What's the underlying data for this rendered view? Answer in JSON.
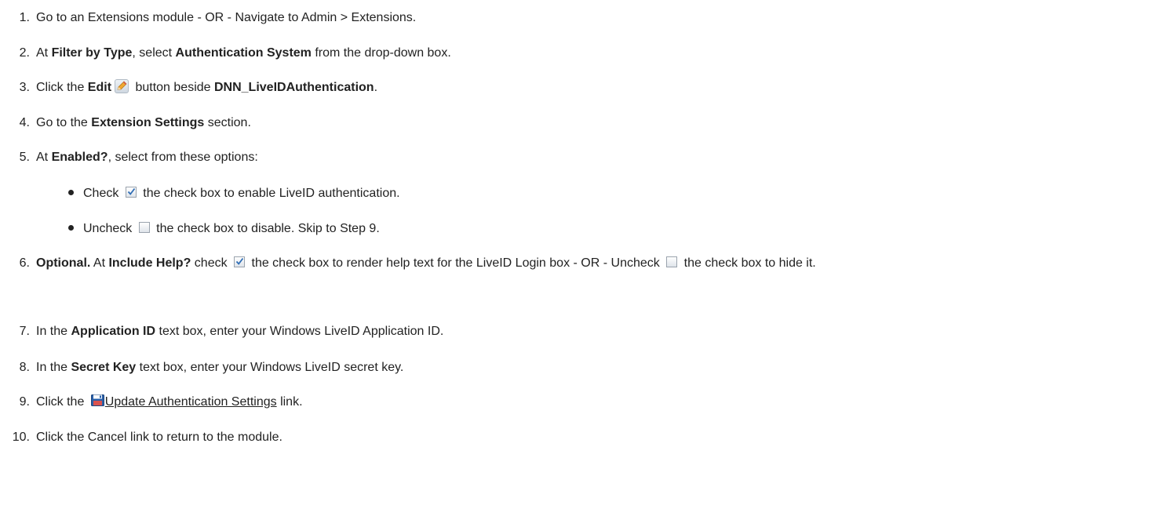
{
  "steps": [
    {
      "num": "1.",
      "parts": [
        "Go to an Extensions module - OR - Navigate to Admin > Extensions."
      ]
    },
    {
      "num": "2.",
      "a": "At ",
      "b1": "Filter by Type",
      "c": ", select ",
      "b2": "Authentication System",
      "d": " from the drop-down box."
    },
    {
      "num": "3.",
      "a": "Click the ",
      "b1": "Edit",
      "c": " button beside ",
      "b2": "DNN_LiveIDAuthentication",
      "d": "."
    },
    {
      "num": "4.",
      "a": "Go to the ",
      "b1": "Extension Settings",
      "c": " section."
    },
    {
      "num": "5.",
      "a": "At ",
      "b1": "Enabled?",
      "c": ", select from these options:"
    },
    {
      "num": "6.",
      "b1": "Optional.",
      "a": " At ",
      "b2": "Include Help?",
      "c": " check ",
      "d": " the check box to render help text for the LiveID Login box - OR - Uncheck ",
      "e": " the check box to hide it."
    },
    {
      "num": "7.",
      "a": "In the ",
      "b1": "Application ID",
      "c": " text box, enter your Windows LiveID Application ID."
    },
    {
      "num": "8.",
      "a": "In the ",
      "b1": "Secret Key",
      "c": " text box, enter your Windows LiveID secret key."
    },
    {
      "num": "9.",
      "a": "Click the ",
      "link": "Update Authentication Settings",
      "c": " link."
    },
    {
      "num": "10.",
      "a": "Click the Cancel link to return to the module."
    }
  ],
  "bullets": [
    {
      "a": "Check ",
      "b": " the check box to enable LiveID authentication."
    },
    {
      "a": "Uncheck ",
      "b": " the check box to disable. Skip to Step 9."
    }
  ],
  "icons": {
    "edit": "pencil-edit-icon",
    "checked": "checkbox-checked-icon",
    "unchecked": "checkbox-unchecked-icon",
    "save": "save-disk-icon"
  }
}
